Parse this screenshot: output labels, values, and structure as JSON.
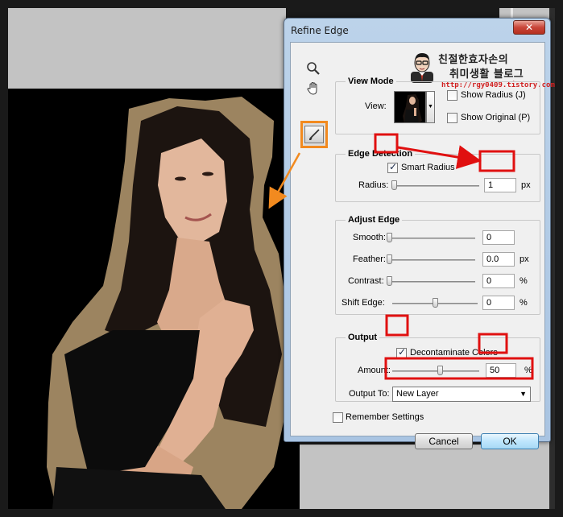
{
  "dialog": {
    "title": "Refine Edge",
    "close_label": "✕"
  },
  "watermark": {
    "title_line1": "친절한효자손의",
    "title_line2": "취미생활 블로그",
    "url": "http://rgy0409.tistory.com"
  },
  "view_mode": {
    "title": "View Mode",
    "view_label": "View:",
    "show_radius": {
      "label": "Show Radius (J)",
      "checked": false
    },
    "show_original": {
      "label": "Show Original (P)",
      "checked": false
    }
  },
  "edge_detection": {
    "title": "Edge Detection",
    "smart_radius": {
      "label": "Smart Radius",
      "checked": true
    },
    "radius_label": "Radius:",
    "radius_value": "1",
    "radius_unit": "px"
  },
  "adjust_edge": {
    "title": "Adjust Edge",
    "smooth": {
      "label": "Smooth:",
      "value": "0",
      "unit": ""
    },
    "feather": {
      "label": "Feather:",
      "value": "0.0",
      "unit": "px"
    },
    "contrast": {
      "label": "Contrast:",
      "value": "0",
      "unit": "%"
    },
    "shift_edge": {
      "label": "Shift Edge:",
      "value": "0",
      "unit": "%"
    }
  },
  "output": {
    "title": "Output",
    "decontaminate": {
      "label": "Decontaminate Colors",
      "checked": true
    },
    "amount_label": "Amount:",
    "amount_value": "50",
    "amount_unit": "%",
    "output_to_label": "Output To:",
    "output_to_value": "New Layer"
  },
  "remember_settings": {
    "label": "Remember Settings",
    "checked": false
  },
  "buttons": {
    "cancel": "Cancel",
    "ok": "OK"
  },
  "colors": {
    "highlight_red": "#e01010",
    "tool_orange": "#f28a1f",
    "arrow_orange": "#f28a1f",
    "halo": "#9c8460"
  }
}
